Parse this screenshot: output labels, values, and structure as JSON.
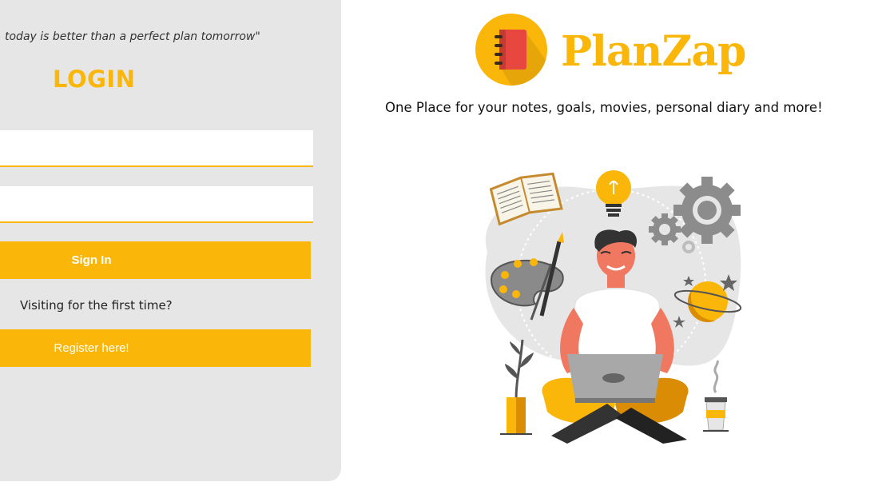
{
  "login": {
    "quote": "today is better than a perfect plan tomorrow\"",
    "title": "LOGIN",
    "username_value": "",
    "password_value": "",
    "sign_in_label": "Sign In",
    "first_time_text": "Visiting for the first time?",
    "register_label": "Register here!"
  },
  "brand": {
    "name": "PlanZap",
    "tagline": "One Place for your notes, goals, movies, personal diary and more!",
    "logo_icon": "notebook-icon",
    "illustration": "person-with-laptop-illustration"
  },
  "colors": {
    "accent": "#fbb60a",
    "panel_bg": "#e6e6e6",
    "button_text": "#ffffff"
  }
}
